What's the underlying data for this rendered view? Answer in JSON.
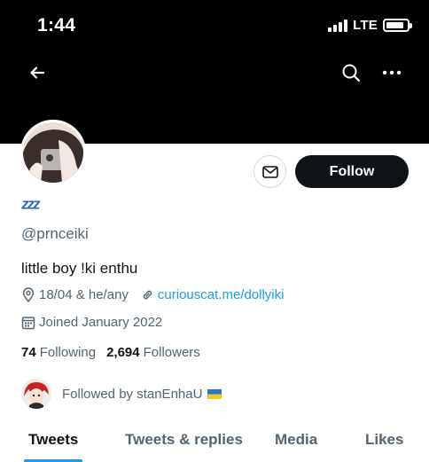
{
  "status_bar": {
    "time": "1:44",
    "network": "LTE",
    "signal_bars": 4,
    "battery_level": 0.85
  },
  "header": {
    "back_icon": "arrow-left-icon",
    "search_icon": "search-icon",
    "more_icon": "more-horizontal-icon"
  },
  "profile": {
    "display_name": "ᶻᶻᶻ",
    "handle": "@prnceiki",
    "bio": "little boy !ki enthu",
    "location": "18/04 & he/any",
    "website": "curiouscat.me/dollyiki",
    "joined": "Joined January 2022",
    "following_count": "74",
    "following_label": "Following",
    "followers_count": "2,694",
    "followers_label": "Followers",
    "followed_by": "Followed by stanEnhaU"
  },
  "actions": {
    "follow_label": "Follow",
    "message_icon": "mail-icon"
  },
  "tabs": [
    {
      "label": "Tweets",
      "active": true
    },
    {
      "label": "Tweets & replies",
      "active": false
    },
    {
      "label": "Media",
      "active": false
    },
    {
      "label": "Likes",
      "active": false
    }
  ],
  "colors": {
    "accent": "#1d9bf0",
    "text": "#0f1419",
    "muted": "#536471",
    "follow_button": "#0f1419",
    "name": "#2b5ec8"
  }
}
